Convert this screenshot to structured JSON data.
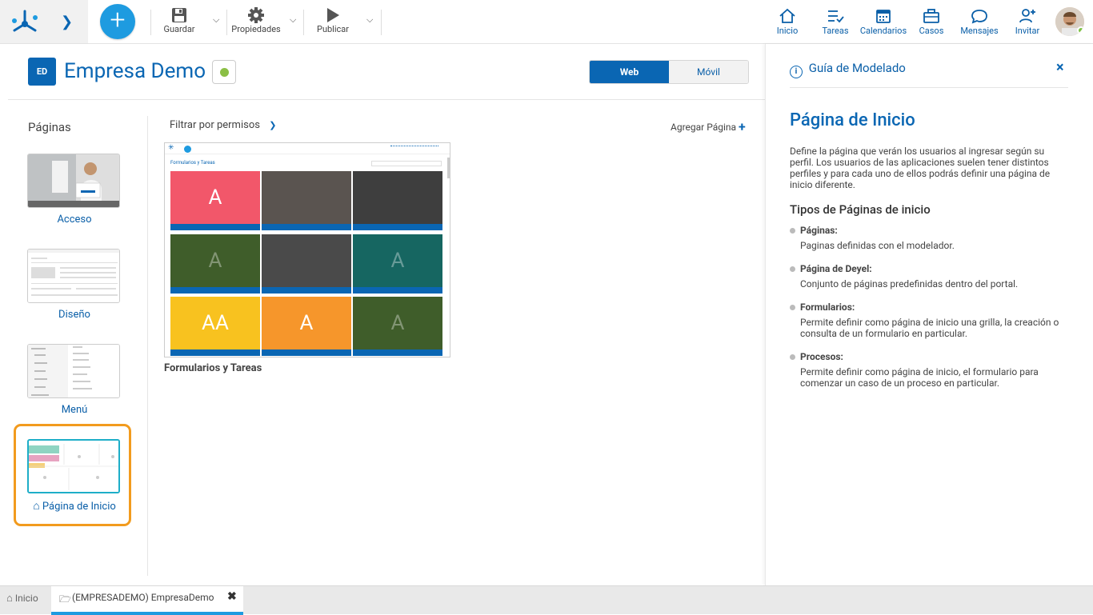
{
  "toolbar": {
    "save_label": "Guardar",
    "properties_label": "Propiedades",
    "publish_label": "Publicar",
    "add_icon": "plus-icon"
  },
  "nav": {
    "home": "Inicio",
    "tasks": "Tareas",
    "calendars": "Calendarios",
    "cases": "Casos",
    "messages": "Mensajes",
    "invite": "Invitar"
  },
  "app": {
    "badge": "ED",
    "title": "Empresa Demo",
    "status_color": "#8bbf45",
    "view_web": "Web",
    "view_mobile": "Móvil"
  },
  "sidebar": {
    "heading": "Páginas",
    "items": [
      {
        "label": "Acceso"
      },
      {
        "label": "Diseño"
      },
      {
        "label": "Menú"
      },
      {
        "label": "Página de Inicio",
        "selected": true
      }
    ]
  },
  "content": {
    "filter_label": "Filtrar por permisos",
    "add_page_label": "Agregar Página",
    "thumbnail_title": "Formularios y Tareas",
    "thumbnail_header": "Formularios y Tareas",
    "tiles": [
      {
        "letter": "A",
        "color": "#f2576a"
      },
      {
        "letter": "",
        "color": "#5a5450"
      },
      {
        "letter": "",
        "color": "#3e3e3e"
      },
      {
        "letter": "A",
        "color": "#3f5d2a"
      },
      {
        "letter": "",
        "color": "#4a4a4a"
      },
      {
        "letter": "A",
        "color": "#166661"
      },
      {
        "letter": "AA",
        "color": "#f8c21f"
      },
      {
        "letter": "A",
        "color": "#f6962b"
      },
      {
        "letter": "A",
        "color": "#3f5d2a"
      }
    ]
  },
  "guide": {
    "header": "Guía de Modelado",
    "close": "×",
    "title": "Página de Inicio",
    "description": "Define la página que verán los usuarios al ingresar según su perfil. Los usuarios de las aplicaciones suelen tener distintos perfiles y para cada uno de ellos podrás definir una página de inicio diferente.",
    "subtitle": "Tipos de Páginas de inicio",
    "items": [
      {
        "title": "Páginas:",
        "desc": "Paginas definidas con el modelador."
      },
      {
        "title": "Página de Deyel:",
        "desc": "Conjunto de páginas predefinidas dentro del portal."
      },
      {
        "title": "Formularios:",
        "desc": "Permite definir como página de inicio una grilla, la creación o consulta de un formulario en particular."
      },
      {
        "title": "Procesos:",
        "desc": "Permite definir como página de inicio, el formulario para comenzar un caso de un proceso en particular."
      }
    ]
  },
  "bottom_tabs": {
    "home": "Inicio",
    "active": "(EMPRESADEMO) EmpresaDemo"
  }
}
